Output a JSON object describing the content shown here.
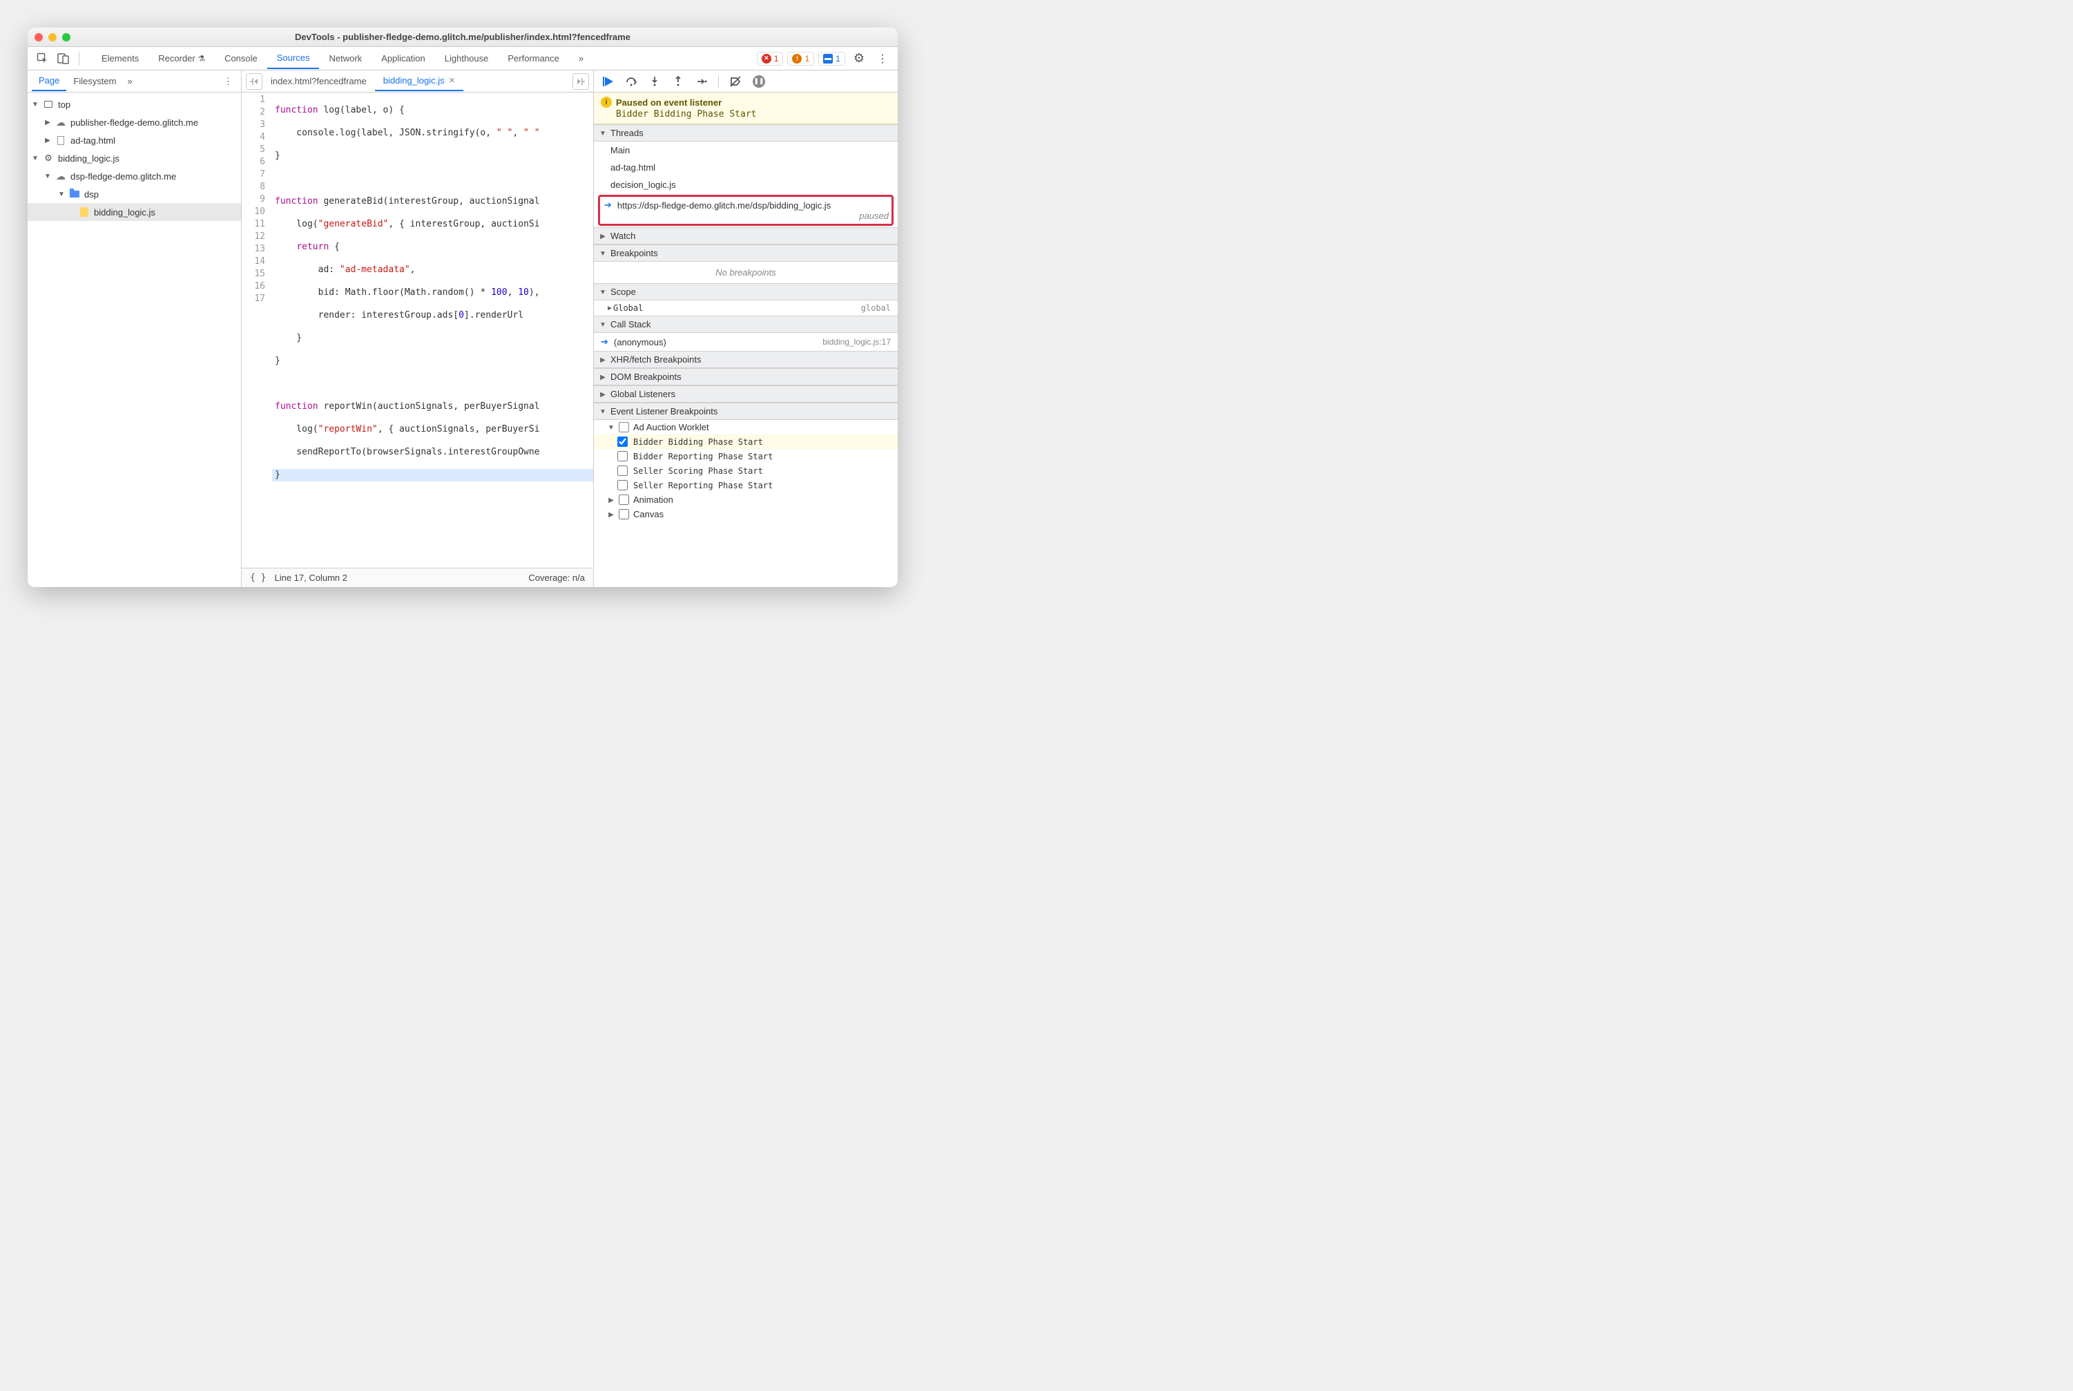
{
  "title": "DevTools - publisher-fledge-demo.glitch.me/publisher/index.html?fencedframe",
  "toolbar": {
    "tabs": [
      "Elements",
      "Recorder",
      "Console",
      "Sources",
      "Network",
      "Application",
      "Lighthouse",
      "Performance"
    ],
    "activeTab": "Sources",
    "errors": "1",
    "warnings": "1",
    "issues": "1"
  },
  "leftTabs": {
    "items": [
      "Page",
      "Filesystem"
    ],
    "active": "Page"
  },
  "tree": {
    "r0": "top",
    "r1": "publisher-fledge-demo.glitch.me",
    "r2": "ad-tag.html",
    "r3": "bidding_logic.js",
    "r4": "dsp-fledge-demo.glitch.me",
    "r5": "dsp",
    "r6": "bidding_logic.js"
  },
  "editorTabs": {
    "t0": "index.html?fencedframe",
    "t1": "bidding_logic.js"
  },
  "code": {
    "lines": [
      "function log(label, o) {",
      "    console.log(label, JSON.stringify(o, \" \", \" \"",
      "}",
      "",
      "function generateBid(interestGroup, auctionSignal",
      "    log(\"generateBid\", { interestGroup, auctionSi",
      "    return {",
      "        ad: \"ad-metadata\",",
      "        bid: Math.floor(Math.random() * 100, 10),",
      "        render: interestGroup.ads[0].renderUrl",
      "    }",
      "}",
      "",
      "function reportWin(auctionSignals, perBuyerSignal",
      "    log(\"reportWin\", { auctionSignals, perBuyerSi",
      "    sendReportTo(browserSignals.interestGroupOwne",
      "}"
    ]
  },
  "status": {
    "pretty": "{ }",
    "pos": "Line 17, Column 2",
    "cov": "Coverage: n/a"
  },
  "pause": {
    "title": "Paused on event listener",
    "sub": "Bidder Bidding Phase Start"
  },
  "panels": {
    "threads": "Threads",
    "watch": "Watch",
    "breakpoints": "Breakpoints",
    "scope": "Scope",
    "callstack": "Call Stack",
    "xhr": "XHR/fetch Breakpoints",
    "dom": "DOM Breakpoints",
    "gl": "Global Listeners",
    "elb": "Event Listener Breakpoints"
  },
  "threads": {
    "t0": "Main",
    "t1": "ad-tag.html",
    "t2": "decision_logic.js",
    "t3": "https://dsp-fledge-demo.glitch.me/dsp/bidding_logic.js",
    "t3s": "paused"
  },
  "breakpoints_empty": "No breakpoints",
  "scope": {
    "global": "Global",
    "globalVal": "global"
  },
  "callstack": {
    "name": "(anonymous)",
    "loc": "bidding_logic.js:17"
  },
  "elb": {
    "cat0": "Ad Auction Worklet",
    "i0": "Bidder Bidding Phase Start",
    "i1": "Bidder Reporting Phase Start",
    "i2": "Seller Scoring Phase Start",
    "i3": "Seller Reporting Phase Start",
    "cat1": "Animation",
    "cat2": "Canvas"
  }
}
